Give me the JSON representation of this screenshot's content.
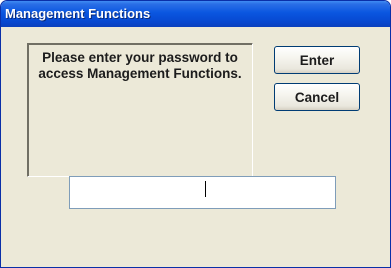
{
  "window": {
    "title": "Management Functions"
  },
  "message": {
    "line1": "Please enter your password to",
    "line2": "access Management Functions."
  },
  "buttons": {
    "enter": "Enter",
    "cancel": "Cancel"
  },
  "password": {
    "value": ""
  },
  "colors": {
    "titlebar": "#0a56e0",
    "dialog_background": "#ece9d8",
    "title_text": "#ffffff"
  }
}
